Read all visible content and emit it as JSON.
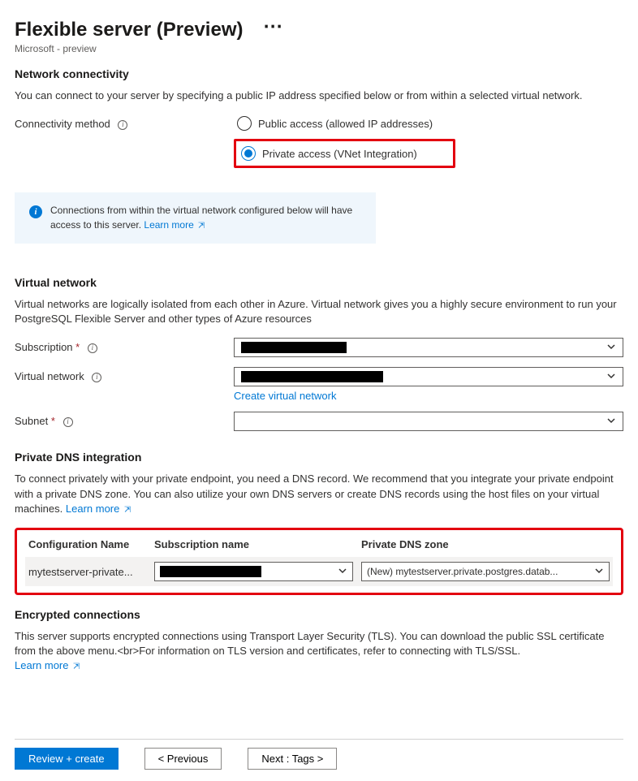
{
  "header": {
    "title": "Flexible server (Preview)",
    "breadcrumb": "Microsoft - preview"
  },
  "connectivity": {
    "heading": "Network connectivity",
    "description": "You can connect to your server by specifying a public IP address specified below or from within a selected virtual network.",
    "method_label": "Connectivity method",
    "option_public": "Public access (allowed IP addresses)",
    "option_private": "Private access (VNet Integration)"
  },
  "info_box": {
    "text": "Connections from within the virtual network configured below will have access to this server.",
    "link": "Learn more"
  },
  "vnet": {
    "heading": "Virtual network",
    "description": "Virtual networks are logically isolated from each other in Azure. Virtual network gives you a highly secure environment to run your PostgreSQL Flexible Server and other types of Azure resources",
    "subscription_label": "Subscription",
    "vnet_label": "Virtual network",
    "create_link": "Create virtual network",
    "subnet_label": "Subnet"
  },
  "dns": {
    "heading": "Private DNS integration",
    "description": "To connect privately with your private endpoint, you need a DNS record. We recommend that you integrate your private endpoint with a private DNS zone. You can also utilize your own DNS servers or create DNS records using the host files on your virtual machines.",
    "link": "Learn more",
    "col_config": "Configuration Name",
    "col_sub": "Subscription name",
    "col_zone": "Private DNS zone",
    "config_value": "mytestserver-private...",
    "zone_value": "(New) mytestserver.private.postgres.datab..."
  },
  "tls": {
    "heading": "Encrypted connections",
    "description": "This server supports encrypted connections using Transport Layer Security (TLS). You can download the public SSL certificate from the above menu.<br>For information on TLS version and certificates, refer to connecting with TLS/SSL.",
    "link": "Learn more"
  },
  "footer": {
    "review": "Review + create",
    "prev": "< Previous",
    "next": "Next : Tags >"
  }
}
